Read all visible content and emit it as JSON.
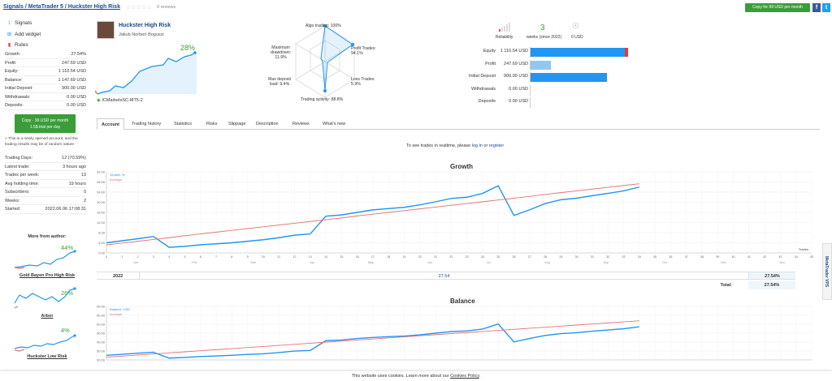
{
  "breadcrumb": {
    "signals": "Signals",
    "sep1": " / ",
    "mt5": "MetaTrader 5",
    "sep2": " / ",
    "current": "Huckster High Risk"
  },
  "rating": {
    "stars": "☆☆☆☆☆",
    "reviews": "0 reviews"
  },
  "top_buttons": {
    "copy": "Copy for 99 USD per month",
    "facebook": "f",
    "twitter": "t"
  },
  "sidebar": {
    "links": [
      {
        "label": "Signals",
        "icon": "signals-icon"
      },
      {
        "label": "Add widget",
        "icon": "plus-icon"
      },
      {
        "label": "Rules",
        "icon": "book-icon"
      }
    ],
    "stats": [
      {
        "k": "Growth:",
        "v": "27.54%"
      },
      {
        "k": "Profit:",
        "v": "247.69 USD"
      },
      {
        "k": "Equity:",
        "v": "1 110.54 USD"
      },
      {
        "k": "Balance:",
        "v": "1 147.69 USD"
      },
      {
        "k": "Initial Deposit:",
        "v": "900.00 USD"
      },
      {
        "k": "Withdrawals:",
        "v": "0.00 USD"
      },
      {
        "k": "Deposits:",
        "v": "0.00 USD"
      }
    ],
    "copy_button": {
      "line1": "Copy · 99 USD per month",
      "line2": "1.5$ trial per day"
    },
    "notice": "This is a newly opened account, and the trading results may be of random nature",
    "stats2": [
      {
        "k": "Trading Days:",
        "v": "12 (70.59%)"
      },
      {
        "k": "Latest trade:",
        "v": "3 hours ago"
      },
      {
        "k": "Trades per week:",
        "v": "13"
      },
      {
        "k": "Avg holding time:",
        "v": "19 hours"
      },
      {
        "k": "Subscribers:",
        "v": "0"
      },
      {
        "k": "Weeks:",
        "v": "2"
      },
      {
        "k": "Started:",
        "v": "2022.06.06 17:08:31"
      }
    ],
    "more_from_author": "More from author:",
    "authors": [
      {
        "name": "Gold Bayen Pro High Risk",
        "pct": "44%"
      },
      {
        "name": "Arbor",
        "pct": "26%"
      },
      {
        "name": "Huckster Low Risk",
        "pct": "4%"
      }
    ]
  },
  "signal": {
    "name": "Huckster High Risk",
    "author": "Jakub Norbert Boguszi",
    "growth": "28%",
    "broker": "ICMarketsSC-MT5-2"
  },
  "radar": {
    "algo": "Algo trading: 100%",
    "profit_trades": "Profit Trades:",
    "profit_trades_v": "94.1%",
    "loss_trades": "Loss Trades:",
    "loss_trades_v": "5.9%",
    "activity": "Trading activity: 88.8%",
    "max_deposit": "Max deposit",
    "max_deposit2": "load: 9.4%",
    "drawdown": "Maximum",
    "drawdown2": "drawdown:",
    "drawdown_v": "11.9%"
  },
  "meta": {
    "reliability": "Reliability",
    "weeks": "3",
    "weeks_label": "weeks (since 2022)",
    "usd": "0 USD"
  },
  "bars": [
    {
      "label": "Equity",
      "value": "1 110.54 USD",
      "fraction": 0.97,
      "color": "#2196f3"
    },
    {
      "label": "Profit",
      "value": "247.69 USD",
      "fraction": 0.21,
      "color": "#90c8f0"
    },
    {
      "label": "Initial Deposit",
      "value": "900.00 USD",
      "fraction": 0.78,
      "color": "#2196f3"
    },
    {
      "label": "Withdrawals",
      "value": "0.00 USD",
      "fraction": 0,
      "color": "#2196f3"
    },
    {
      "label": "Deposits",
      "value": "0.00 USD",
      "fraction": 0,
      "color": "#2196f3"
    }
  ],
  "tabs": [
    "Account",
    "Trading history",
    "Statistics",
    "Risks",
    "Slippage",
    "Description",
    "Reviews",
    "What's new"
  ],
  "realtime": {
    "pre": "To see trades in realtime, please ",
    "login": "log in",
    "mid": " or ",
    "register": "register"
  },
  "ytd": {
    "year": "2022",
    "value": "27.54",
    "ytd_label": "YTD",
    "ytd_value": "27.54%",
    "total_label": "Total:",
    "total_value": "27.54%"
  },
  "cookie": {
    "text": "This website uses cookies. Learn more about our ",
    "link": "Cookies Policy",
    "end": "."
  },
  "vps": "MetaTrader VPS",
  "chart_data": [
    {
      "type": "line",
      "title": "Growth",
      "ylim": [
        0,
        32
      ],
      "yticks": [
        "32.00",
        "28.00",
        "24.00",
        "20.00",
        "16.00",
        "12.00",
        "8.00",
        "4.00",
        "0.00"
      ],
      "x": [
        0,
        1,
        2,
        3,
        4,
        5,
        6,
        7,
        8,
        9,
        10,
        11,
        12,
        13,
        14,
        15,
        16,
        17,
        18,
        19,
        20,
        21,
        22,
        23,
        24,
        25,
        26,
        27,
        28,
        29,
        30,
        31,
        32,
        33,
        34
      ],
      "series": [
        {
          "name": "Growth, %",
          "color": "#2196f3",
          "values": [
            4,
            4.8,
            5.6,
            6.5,
            2.2,
            2.6,
            3.2,
            3.6,
            4,
            4.6,
            5.2,
            6,
            7,
            7.5,
            14.5,
            15,
            16,
            17,
            17.5,
            18,
            19,
            20.2,
            21.5,
            22,
            23.5,
            26.5,
            14.8,
            17,
            19.5,
            21,
            21.6,
            22.6,
            23.5,
            24.5,
            26
          ]
        },
        {
          "name": "Average",
          "color": "#e57373",
          "values": [
            3.2,
            3.9,
            4.6,
            5.3,
            6,
            6.8,
            7.5,
            8.2,
            8.9,
            9.6,
            10.3,
            11,
            11.7,
            12.4,
            13.1,
            13.8,
            14.6,
            15.3,
            16,
            16.7,
            17.4,
            18.1,
            18.8,
            19.5,
            20.2,
            20.9,
            21.6,
            22.3,
            23.1,
            23.8,
            24.5,
            25.2,
            25.9,
            26.6,
            27.3
          ]
        }
      ],
      "months": [
        "Jan",
        "Feb",
        "Mar",
        "Apr",
        "May",
        "Jun",
        "Jul",
        "Aug",
        "Sep",
        "Oct",
        "Nov",
        "Dec"
      ],
      "trades_label": "Trades",
      "xmax": 45
    },
    {
      "type": "line",
      "title": "Balance",
      "ylim": [
        850,
        1200
      ],
      "yticks": [
        "1 200.00",
        "1 150.00",
        "1 100.00",
        "1 050.00",
        "1 000.00",
        "950.00",
        "900.00"
      ],
      "x": [
        0,
        1,
        2,
        3,
        4,
        5,
        6,
        7,
        8,
        9,
        10,
        11,
        12,
        13,
        14,
        15,
        16,
        17,
        18,
        19,
        20,
        21,
        22,
        23,
        24,
        25,
        26,
        27,
        28,
        29,
        30,
        31,
        32,
        33,
        34
      ],
      "series": [
        {
          "name": "Balance, USD",
          "color": "#2196f3",
          "values": [
            880,
            887,
            894,
            900,
            862,
            866,
            872,
            876,
            880,
            886,
            890,
            898,
            908,
            912,
            976,
            980,
            990,
            997,
            1002,
            1006,
            1014,
            1025,
            1035,
            1040,
            1052,
            1085,
            968,
            990,
            1010,
            1022,
            1028,
            1038,
            1046,
            1054,
            1067
          ]
        },
        {
          "name": "Average",
          "color": "#e57373",
          "values": [
            868,
            875,
            882,
            889,
            896,
            903,
            910,
            917,
            924,
            931,
            938,
            945,
            952,
            959,
            966,
            973,
            980,
            987,
            994,
            1001,
            1008,
            1015,
            1022,
            1029,
            1036,
            1043,
            1050,
            1057,
            1064,
            1071,
            1078,
            1085,
            1092,
            1099,
            1106
          ]
        }
      ]
    }
  ]
}
